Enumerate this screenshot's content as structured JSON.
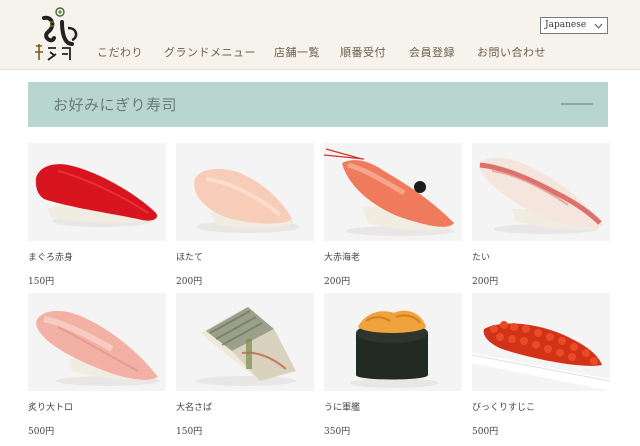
{
  "header": {
    "language": {
      "selected": "Japanese"
    },
    "nav": [
      {
        "label": "こだわり"
      },
      {
        "label": "グランドメニュー"
      },
      {
        "label": "店舗一覧"
      },
      {
        "label": "順番受付"
      },
      {
        "label": "会員登録"
      },
      {
        "label": "お問い合わせ"
      }
    ]
  },
  "section": {
    "title": "お好みにぎり寿司"
  },
  "menu": [
    {
      "name": "まぐろ赤身",
      "price": "150円"
    },
    {
      "name": "ほたて",
      "price": "200円"
    },
    {
      "name": "大赤海老",
      "price": "200円"
    },
    {
      "name": "たい",
      "price": "200円"
    },
    {
      "name": "炙り大トロ",
      "price": "500円"
    },
    {
      "name": "大名さば",
      "price": "150円"
    },
    {
      "name": "うに軍艦",
      "price": "350円"
    },
    {
      "name": "びっくりすじこ",
      "price": "500円"
    }
  ],
  "colors": {
    "header_bg": "#f6f3ec",
    "banner_bg": "#b9d6ce",
    "nav_text": "#6b5d4a"
  }
}
